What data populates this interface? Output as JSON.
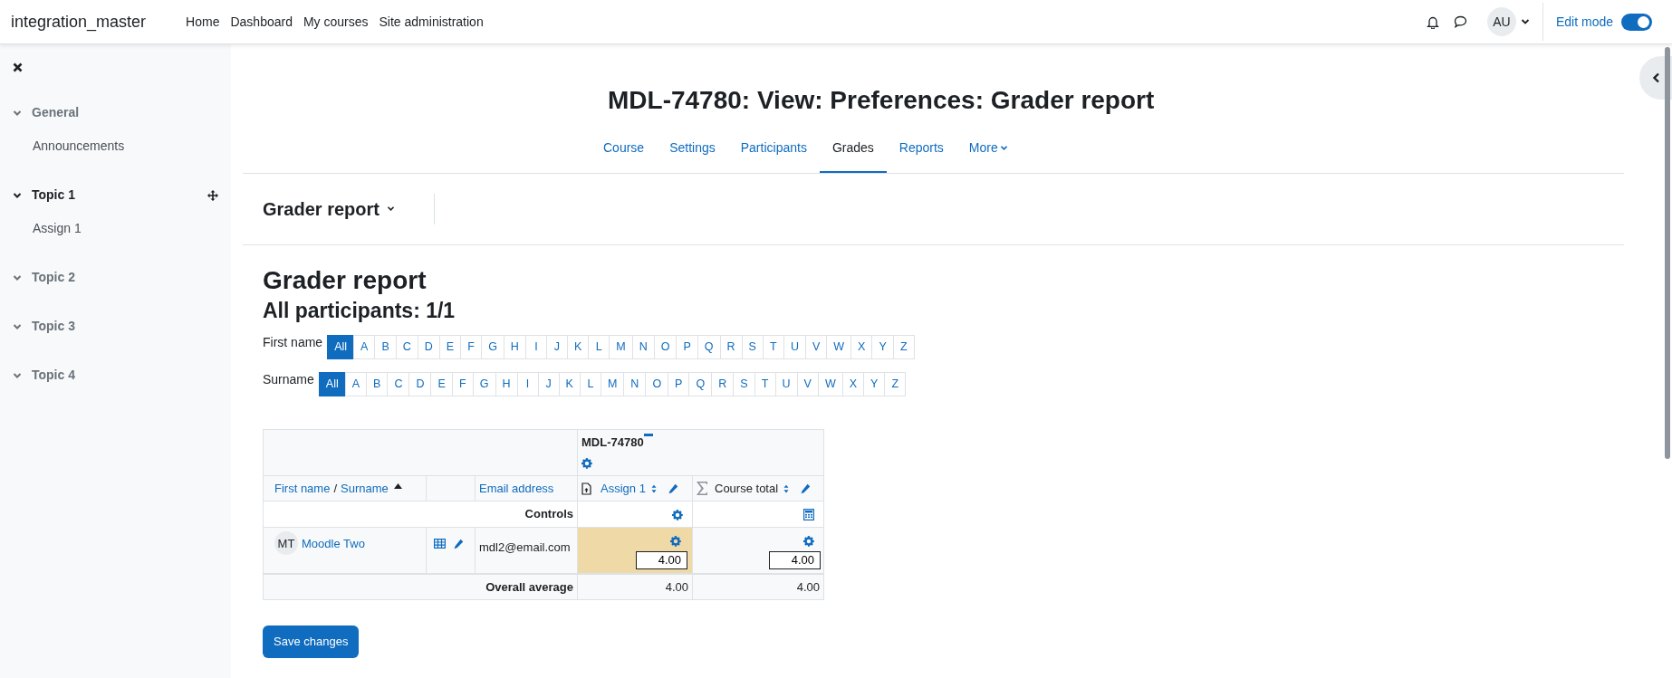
{
  "navbar": {
    "brand": "integration_master",
    "links": [
      {
        "label": "Home"
      },
      {
        "label": "Dashboard"
      },
      {
        "label": "My courses"
      },
      {
        "label": "Site administration"
      }
    ],
    "avatar": "AU",
    "edit_mode": {
      "label": "Edit mode",
      "on": true
    }
  },
  "sidebar": {
    "sections": [
      {
        "title": "General",
        "expanded": true,
        "selected": false,
        "children": [
          {
            "label": "Announcements"
          }
        ]
      },
      {
        "title": "Topic 1",
        "expanded": true,
        "selected": true,
        "children": [
          {
            "label": "Assign 1"
          }
        ]
      },
      {
        "title": "Topic 2",
        "expanded": true,
        "selected": false
      },
      {
        "title": "Topic 3",
        "expanded": true,
        "selected": false
      },
      {
        "title": "Topic 4",
        "expanded": true,
        "selected": false
      }
    ]
  },
  "page_title": "MDL-74780: View: Preferences: Grader report",
  "tabs": [
    {
      "label": "Course",
      "selected": false,
      "has_menu": false
    },
    {
      "label": "Settings",
      "selected": false,
      "has_menu": false
    },
    {
      "label": "Participants",
      "selected": false,
      "has_menu": false
    },
    {
      "label": "Grades",
      "selected": true,
      "has_menu": false
    },
    {
      "label": "Reports",
      "selected": false,
      "has_menu": false
    },
    {
      "label": "More",
      "selected": false,
      "has_menu": true
    }
  ],
  "report_selector": "Grader report",
  "heading": "Grader report",
  "subheading": "All participants: 1/1",
  "filters": [
    {
      "label": "First name",
      "letters": [
        {
          "label": "All",
          "selected": true
        },
        {
          "label": "A",
          "selected": false
        },
        {
          "label": "B",
          "selected": false
        },
        {
          "label": "C",
          "selected": false
        },
        {
          "label": "D",
          "selected": false
        },
        {
          "label": "E",
          "selected": false
        },
        {
          "label": "F",
          "selected": false
        },
        {
          "label": "G",
          "selected": false
        },
        {
          "label": "H",
          "selected": false
        },
        {
          "label": "I",
          "selected": false
        },
        {
          "label": "J",
          "selected": false
        },
        {
          "label": "K",
          "selected": false
        },
        {
          "label": "L",
          "selected": false
        },
        {
          "label": "M",
          "selected": false
        },
        {
          "label": "N",
          "selected": false
        },
        {
          "label": "O",
          "selected": false
        },
        {
          "label": "P",
          "selected": false
        },
        {
          "label": "Q",
          "selected": false
        },
        {
          "label": "R",
          "selected": false
        },
        {
          "label": "S",
          "selected": false
        },
        {
          "label": "T",
          "selected": false
        },
        {
          "label": "U",
          "selected": false
        },
        {
          "label": "V",
          "selected": false
        },
        {
          "label": "W",
          "selected": false
        },
        {
          "label": "X",
          "selected": false
        },
        {
          "label": "Y",
          "selected": false
        },
        {
          "label": "Z",
          "selected": false
        }
      ]
    },
    {
      "label": "Surname",
      "letters": [
        {
          "label": "All",
          "selected": true
        },
        {
          "label": "A",
          "selected": false
        },
        {
          "label": "B",
          "selected": false
        },
        {
          "label": "C",
          "selected": false
        },
        {
          "label": "D",
          "selected": false
        },
        {
          "label": "E",
          "selected": false
        },
        {
          "label": "F",
          "selected": false
        },
        {
          "label": "G",
          "selected": false
        },
        {
          "label": "H",
          "selected": false
        },
        {
          "label": "I",
          "selected": false
        },
        {
          "label": "J",
          "selected": false
        },
        {
          "label": "K",
          "selected": false
        },
        {
          "label": "L",
          "selected": false
        },
        {
          "label": "M",
          "selected": false
        },
        {
          "label": "N",
          "selected": false
        },
        {
          "label": "O",
          "selected": false
        },
        {
          "label": "P",
          "selected": false
        },
        {
          "label": "Q",
          "selected": false
        },
        {
          "label": "R",
          "selected": false
        },
        {
          "label": "S",
          "selected": false
        },
        {
          "label": "T",
          "selected": false
        },
        {
          "label": "U",
          "selected": false
        },
        {
          "label": "V",
          "selected": false
        },
        {
          "label": "W",
          "selected": false
        },
        {
          "label": "X",
          "selected": false
        },
        {
          "label": "Y",
          "selected": false
        },
        {
          "label": "Z",
          "selected": false
        }
      ]
    }
  ],
  "table": {
    "category": "MDL-74780",
    "columns": {
      "first_name": "First name",
      "separator": "/",
      "surname": "Surname",
      "email": "Email address"
    },
    "items": [
      {
        "label": "Assign 1",
        "kind": "assignment"
      },
      {
        "label": "Course total",
        "kind": "total"
      }
    ],
    "controls_label": "Controls",
    "rows": [
      {
        "initials": "MT",
        "name": "Moodle Two",
        "email": "mdl2@email.com",
        "grades": [
          {
            "value": "4.00",
            "overridden": true
          },
          {
            "value": "4.00",
            "overridden": false
          }
        ]
      }
    ],
    "average": {
      "label": "Overall average",
      "values": [
        "4.00",
        "4.00"
      ]
    }
  },
  "save_button": "Save changes"
}
